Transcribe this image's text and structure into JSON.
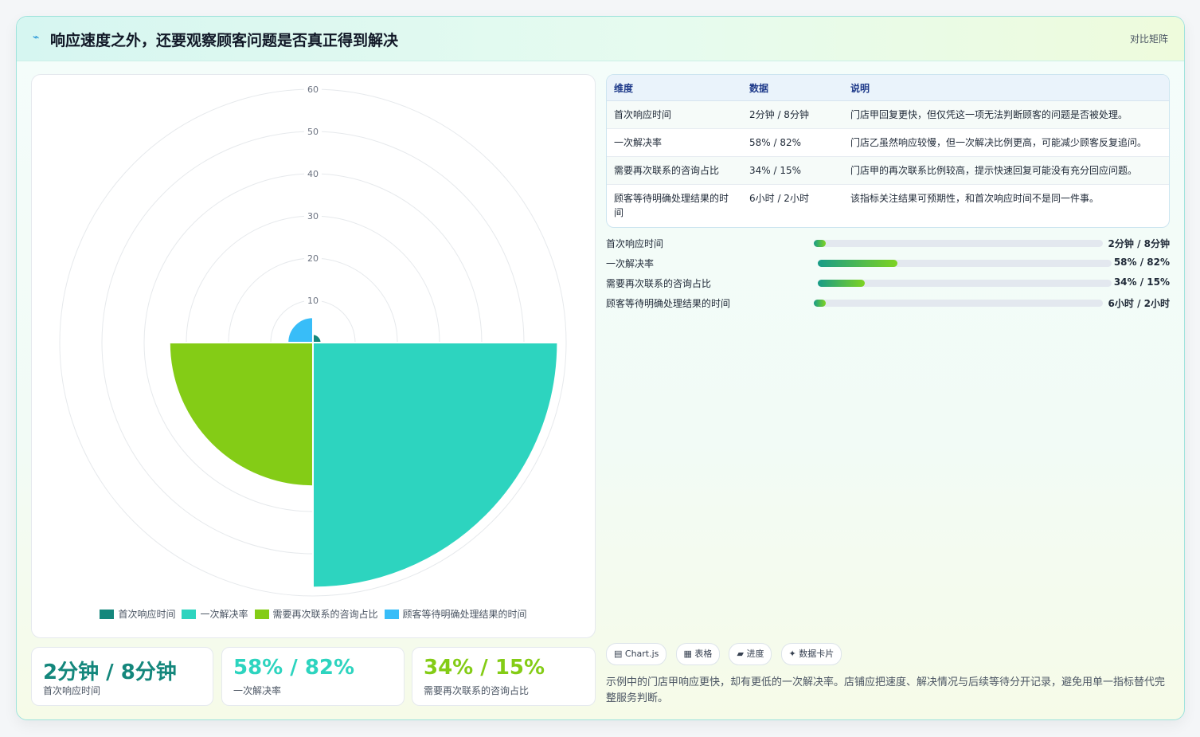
{
  "header": {
    "icon": "pulse-icon",
    "title": "响应速度之外，还要观察顾客问题是否真正得到解决",
    "tag": "对比矩阵"
  },
  "colors": {
    "teal": "#14877c",
    "aqua": "#2dd4bf",
    "lime": "#84cc16",
    "sky": "#38bdf8"
  },
  "chart_data": {
    "type": "polarArea",
    "r_ticks": [
      "10",
      "20",
      "30",
      "40",
      "50",
      "60"
    ],
    "r_max": 60,
    "categories": [
      "首次响应时间",
      "一次解决率",
      "需要再次联系的咨询占比",
      "顾客等待明确处理结果的时间"
    ],
    "values": [
      2,
      58,
      34,
      6
    ],
    "colors": [
      "#14877c",
      "#2dd4bf",
      "#84cc16",
      "#38bdf8"
    ],
    "legend_position": "bottom"
  },
  "kpis": [
    {
      "value": "2分钟 / 8分钟",
      "label": "首次响应时间",
      "color": "#14877c"
    },
    {
      "value": "58% / 82%",
      "label": "一次解决率",
      "color": "#2dd4bf"
    },
    {
      "value": "34% / 15%",
      "label": "需要再次联系的咨询占比",
      "color": "#84cc16"
    }
  ],
  "table": {
    "headers": [
      "维度",
      "数据",
      "说明"
    ],
    "rows": [
      [
        "首次响应时间",
        "2分钟 / 8分钟",
        "门店甲回复更快，但仅凭这一项无法判断顾客的问题是否被处理。"
      ],
      [
        "一次解决率",
        "58% / 82%",
        "门店乙虽然响应较慢，但一次解决比例更高，可能减少顾客反复追问。"
      ],
      [
        "需要再次联系的咨询占比",
        "34% / 15%",
        "门店甲的再次联系比例较高，提示快速回复可能没有充分回应问题。"
      ],
      [
        "顾客等待明确处理结果的时间",
        "6小时 / 2小时",
        "该指标关注结果可预期性，和首次响应时间不是同一件事。"
      ]
    ]
  },
  "bars": [
    {
      "label": "首次响应时间",
      "value": "2分钟 / 8分钟",
      "fraction": 0.04
    },
    {
      "label": "一次解决率",
      "value": "58% / 82%",
      "fraction": 0.27
    },
    {
      "label": "需要再次联系的咨询占比",
      "value": "34% / 15%",
      "fraction": 0.16
    },
    {
      "label": "顾客等待明确处理结果的时间",
      "value": "6小时 / 2小时",
      "fraction": 0.04
    }
  ],
  "chips": [
    "▤ Chart.js",
    "▦ 表格",
    "▰ 进度",
    "✦ 数据卡片"
  ],
  "note": "示例中的门店甲响应更快，却有更低的一次解决率。店铺应把速度、解决情况与后续等待分开记录，避免用单一指标替代完整服务判断。"
}
